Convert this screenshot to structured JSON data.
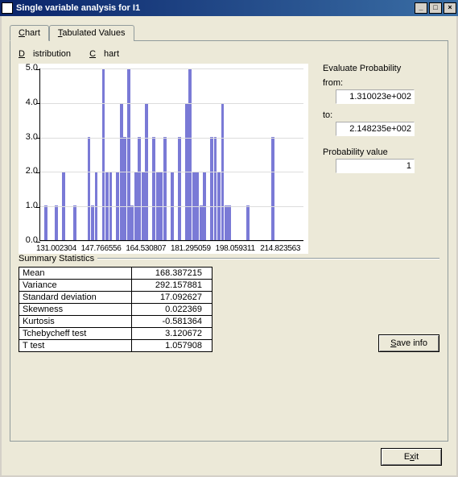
{
  "window": {
    "title": "Single variable analysis for I1"
  },
  "tabs": [
    {
      "label_u": "C",
      "label_rest": "hart"
    },
    {
      "label_u": "T",
      "label_rest": "abulated Values"
    }
  ],
  "menubar": {
    "item1_u": "D",
    "item1_rest": "istribution",
    "item2_u": "C",
    "item2_rest": "hart"
  },
  "probability": {
    "title": "Evaluate Probability",
    "from_label": "from:",
    "from_value": "1.310023e+002",
    "to_label": "to:",
    "to_value": "2.148235e+002",
    "pv_label": "Probability value",
    "pv_value": "1"
  },
  "summary": {
    "title": "Summary Statistics",
    "rows": [
      {
        "k": "Mean",
        "v": "168.387215"
      },
      {
        "k": "Variance",
        "v": "292.157881"
      },
      {
        "k": "Standard deviation",
        "v": "17.092627"
      },
      {
        "k": "Skewness",
        "v": "0.022369"
      },
      {
        "k": "Kurtosis",
        "v": "-0.581364"
      },
      {
        "k": "Tchebycheff test",
        "v": "3.120672"
      },
      {
        "k": "T test",
        "v": "1.057908"
      }
    ]
  },
  "buttons": {
    "save_u": "S",
    "save_rest": "ave info",
    "exit_u": "x",
    "exit_pre": "E",
    "exit_post": "it"
  },
  "chart_data": {
    "type": "bar",
    "ylim": [
      0.0,
      5.0
    ],
    "yticks": [
      0.0,
      1.0,
      2.0,
      3.0,
      4.0,
      5.0
    ],
    "xaxis_labels": [
      "131.002304",
      "147.766556",
      "164.530807",
      "181.295059",
      "198.059311",
      "214.823563"
    ],
    "values": [
      0,
      1,
      0,
      0,
      1,
      0,
      2,
      0,
      0,
      1,
      0,
      0,
      0,
      3,
      1,
      2,
      0,
      5,
      2,
      2,
      0,
      2,
      4,
      3,
      5,
      1,
      2,
      3,
      2,
      4,
      0,
      3,
      2,
      2,
      3,
      0,
      2,
      0,
      3,
      0,
      4,
      5,
      2,
      2,
      1,
      2,
      0,
      3,
      3,
      2,
      4,
      1,
      1,
      0,
      0,
      0,
      0,
      1,
      0,
      0,
      0,
      0,
      0,
      0,
      3,
      0,
      0,
      0,
      0,
      0,
      0,
      0,
      0
    ]
  }
}
